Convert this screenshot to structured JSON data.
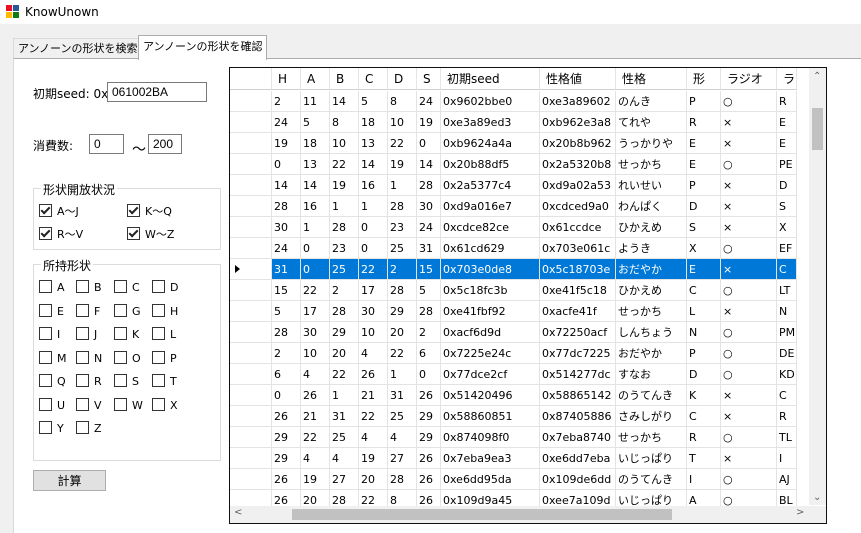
{
  "window": {
    "title": "KnowUnown"
  },
  "tabs": [
    "アンノーンの形状を検索",
    "アンノーンの形状を確認"
  ],
  "seed": {
    "label": "初期seed: 0x",
    "value": "061002BA"
  },
  "consumption": {
    "label": "消費数:",
    "from": "0",
    "sep": "～",
    "to": "200"
  },
  "open_status": {
    "title": "形状開放状況",
    "items": [
      {
        "label": "A～J",
        "checked": true
      },
      {
        "label": "K～Q",
        "checked": true
      },
      {
        "label": "R～V",
        "checked": true
      },
      {
        "label": "W～Z",
        "checked": true
      }
    ]
  },
  "owned": {
    "title": "所持形状",
    "letters": [
      "A",
      "B",
      "C",
      "D",
      "E",
      "F",
      "G",
      "H",
      "I",
      "J",
      "K",
      "L",
      "M",
      "N",
      "O",
      "P",
      "Q",
      "R",
      "S",
      "T",
      "U",
      "V",
      "W",
      "X",
      "Y",
      "Z"
    ]
  },
  "calc_button": "計算",
  "table": {
    "columns": [
      "H",
      "A",
      "B",
      "C",
      "D",
      "S",
      "初期seed",
      "性格値",
      "性格",
      "形",
      "ラジオ",
      "ラ"
    ],
    "selected_row": 9,
    "rows": [
      [
        "2",
        "11",
        "14",
        "5",
        "8",
        "24",
        "0x9602bbe0",
        "0xe3a89602",
        "のんき",
        "P",
        "○",
        "R"
      ],
      [
        "24",
        "5",
        "8",
        "18",
        "10",
        "19",
        "0xe3a89ed3",
        "0xb962e3a8",
        "てれや",
        "R",
        "×",
        "E"
      ],
      [
        "19",
        "18",
        "10",
        "13",
        "22",
        "0",
        "0xb9624a4a",
        "0x20b8b962",
        "うっかりや",
        "E",
        "×",
        "E"
      ],
      [
        "0",
        "13",
        "22",
        "14",
        "19",
        "14",
        "0x20b88df5",
        "0x2a5320b8",
        "せっかち",
        "E",
        "○",
        "PE"
      ],
      [
        "14",
        "14",
        "19",
        "16",
        "1",
        "28",
        "0x2a5377c4",
        "0xd9a02a53",
        "れいせい",
        "P",
        "×",
        "D"
      ],
      [
        "28",
        "16",
        "1",
        "1",
        "28",
        "30",
        "0xd9a016e7",
        "0xcdced9a0",
        "わんぱく",
        "D",
        "×",
        "S"
      ],
      [
        "30",
        "1",
        "28",
        "0",
        "23",
        "24",
        "0xcdce82ce",
        "0x61ccdce",
        "ひかえめ",
        "S",
        "×",
        "X"
      ],
      [
        "24",
        "0",
        "23",
        "0",
        "25",
        "31",
        "0x61cd629",
        "0x703e061c",
        "ようき",
        "X",
        "○",
        "EF"
      ],
      [
        "31",
        "0",
        "25",
        "22",
        "2",
        "15",
        "0x703e0de8",
        "0x5c18703e",
        "おだやか",
        "E",
        "×",
        "C"
      ],
      [
        "15",
        "22",
        "2",
        "17",
        "28",
        "5",
        "0x5c18fc3b",
        "0xe41f5c18",
        "ひかえめ",
        "C",
        "○",
        "LT"
      ],
      [
        "5",
        "17",
        "28",
        "30",
        "29",
        "28",
        "0xe41fbf92",
        "0xacfe41f",
        "せっかち",
        "L",
        "×",
        "N"
      ],
      [
        "28",
        "30",
        "29",
        "10",
        "20",
        "2",
        "0xacf6d9d",
        "0x72250acf",
        "しんちょう",
        "N",
        "○",
        "PM"
      ],
      [
        "2",
        "10",
        "20",
        "4",
        "22",
        "6",
        "0x7225e24c",
        "0x77dc7225",
        "おだやか",
        "P",
        "○",
        "DE"
      ],
      [
        "6",
        "4",
        "22",
        "26",
        "1",
        "0",
        "0x77dce2cf",
        "0x514277dc",
        "すなお",
        "D",
        "○",
        "KD"
      ],
      [
        "0",
        "26",
        "1",
        "21",
        "31",
        "26",
        "0x51420496",
        "0x58865142",
        "のうてんき",
        "K",
        "×",
        "C"
      ],
      [
        "26",
        "21",
        "31",
        "22",
        "25",
        "29",
        "0x58860851",
        "0x87405886",
        "さみしがり",
        "C",
        "×",
        "R"
      ],
      [
        "29",
        "22",
        "25",
        "4",
        "4",
        "29",
        "0x874098f0",
        "0x7eba8740",
        "せっかち",
        "R",
        "○",
        "TL"
      ],
      [
        "29",
        "4",
        "4",
        "19",
        "27",
        "26",
        "0x7eba9ea3",
        "0xe6dd7eba",
        "いじっぱり",
        "T",
        "×",
        "I"
      ],
      [
        "26",
        "19",
        "27",
        "20",
        "28",
        "26",
        "0xe6dd95da",
        "0x109de6dd",
        "のうてんき",
        "I",
        "○",
        "AJ"
      ],
      [
        "26",
        "20",
        "28",
        "22",
        "8",
        "26",
        "0x109d9a45",
        "0xee7a109d",
        "いじっぱり",
        "A",
        "○",
        "BL"
      ]
    ]
  }
}
